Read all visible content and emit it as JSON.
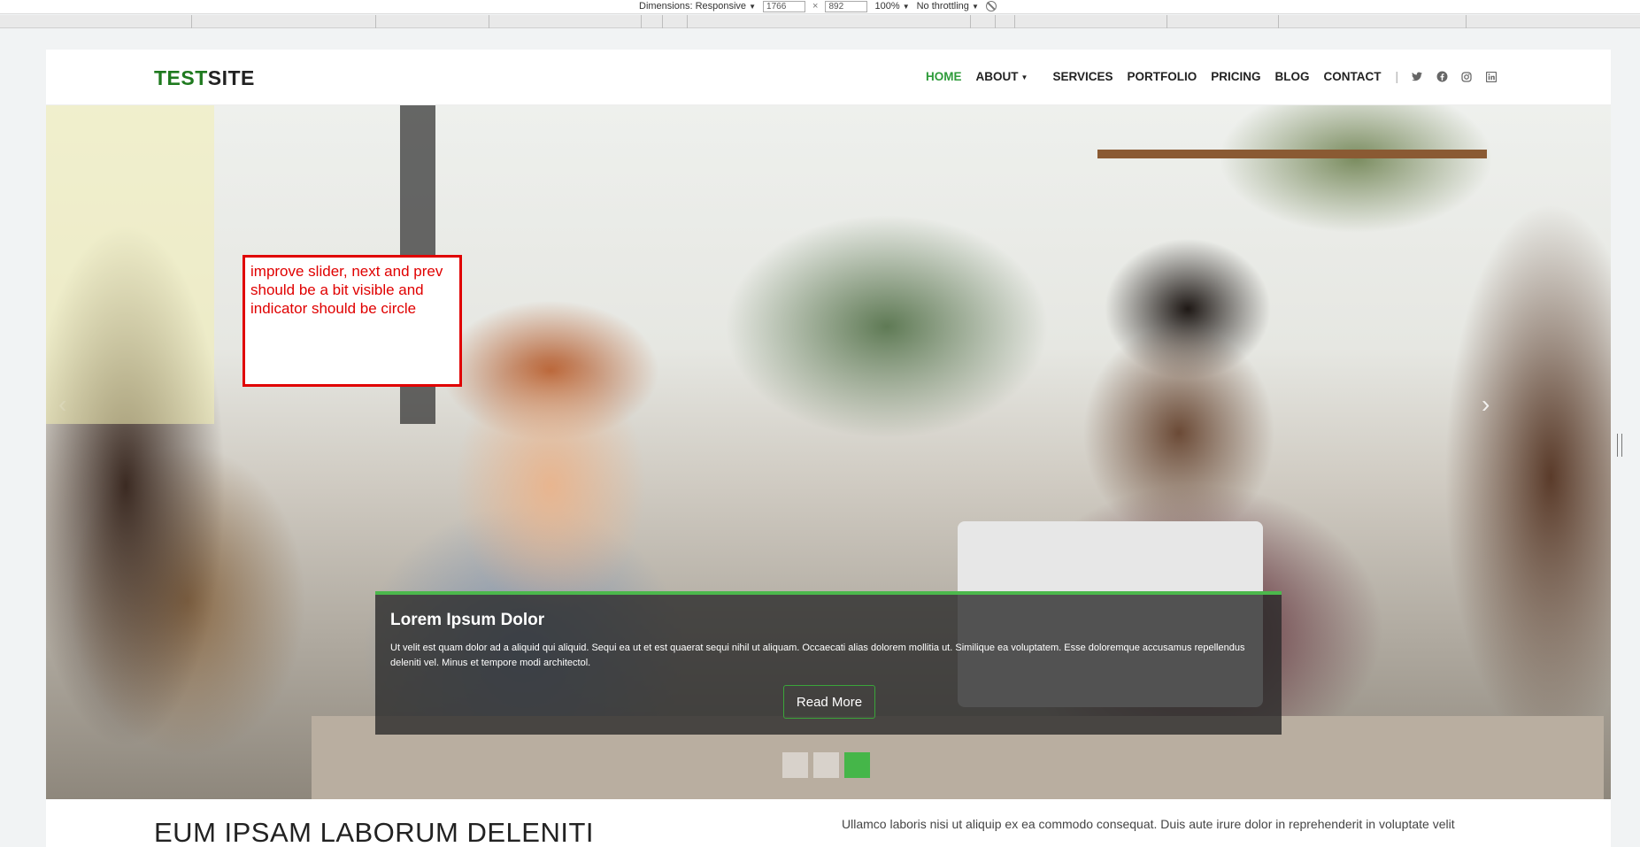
{
  "devtools": {
    "dimensions_label": "Dimensions: Responsive",
    "width": "1766",
    "times": "×",
    "height": "892",
    "zoom": "100%",
    "throttling": "No throttling",
    "caret": "▼"
  },
  "header": {
    "logo_green": "TEST",
    "logo_dark": "SITE",
    "nav": {
      "home": "HOME",
      "about": "ABOUT",
      "services": "SERVICES",
      "portfolio": "PORTFOLIO",
      "pricing": "PRICING",
      "blog": "BLOG",
      "contact": "CONTACT"
    },
    "separator": "|",
    "social_icons": [
      "twitter-icon",
      "facebook-icon",
      "instagram-icon",
      "linkedin-icon"
    ]
  },
  "slider": {
    "caption_title": "Lorem Ipsum Dolor",
    "caption_text": "Ut velit est quam dolor ad a aliquid qui aliquid. Sequi ea ut et est quaerat sequi nihil ut aliquam. Occaecati alias dolorem mollitia ut. Similique ea voluptatem. Esse doloremque accusamus repellendus deleniti vel. Minus et tempore modi architectol.",
    "button_label": "Read More",
    "indicator_count": 3,
    "active_indicator": 3,
    "next_glyph": "›",
    "prev_glyph": "‹",
    "accent_color": "#45b649"
  },
  "annotation": {
    "text": "improve slider, next and prev should be a bit visible and indicator should be circle",
    "color": "#e00000"
  },
  "below": {
    "heading": "EUM IPSAM LABORUM DELENITI",
    "paragraph": "Ullamco laboris nisi ut aliquip ex ea commodo consequat. Duis aute irure dolor in reprehenderit in voluptate velit"
  }
}
